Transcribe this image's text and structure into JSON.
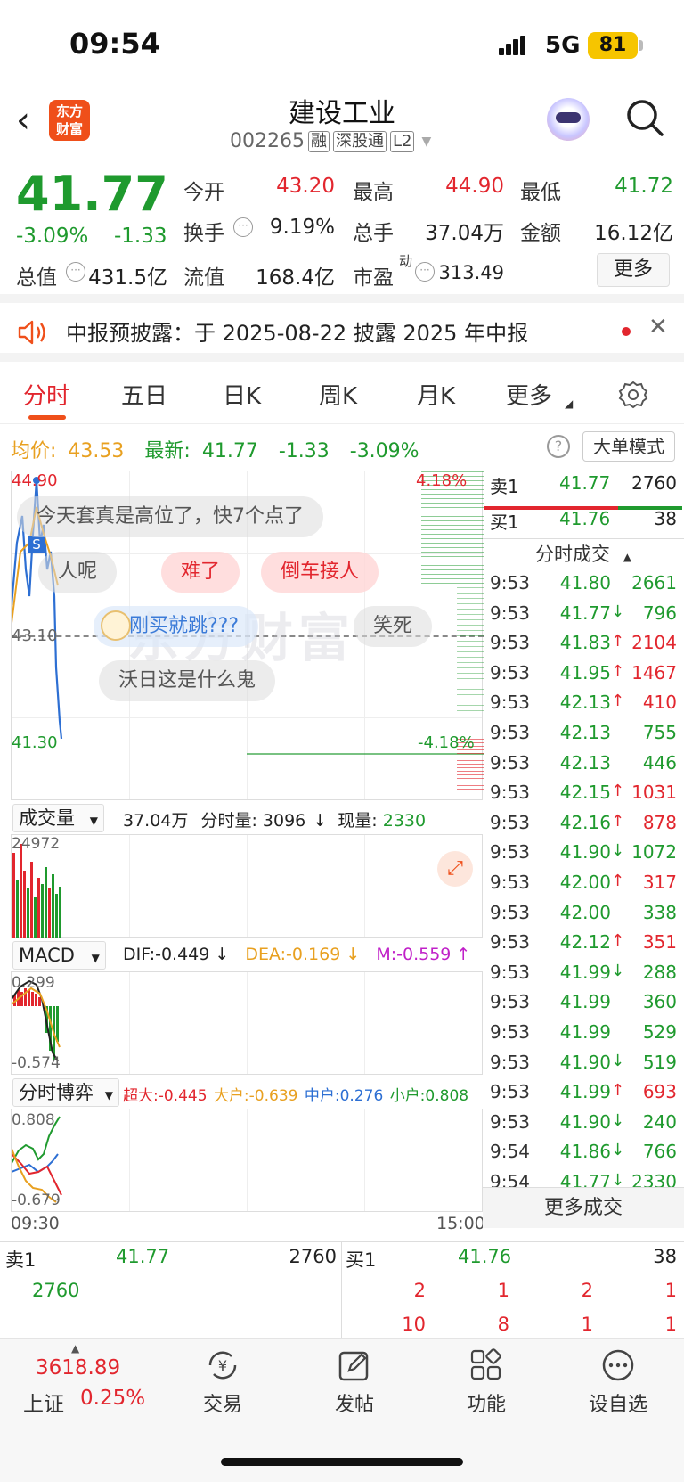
{
  "status_bar": {
    "time": "09:54",
    "network": "5G",
    "battery": "81"
  },
  "header": {
    "logo_line1": "东方",
    "logo_line2": "财富",
    "stock_name": "建设工业",
    "stock_code": "002265",
    "tags": [
      "融",
      "深股通",
      "L2"
    ]
  },
  "quote": {
    "price": "41.77",
    "change_pct": "-3.09%",
    "change": "-1.33",
    "open_label": "今开",
    "open": "43.20",
    "high_label": "最高",
    "high": "44.90",
    "low_label": "最低",
    "low": "41.72",
    "turnover_label": "换手",
    "turnover": "9.19%",
    "volume_label": "总手",
    "volume": "37.04万",
    "amount_label": "金额",
    "amount": "16.12亿",
    "mktcap_label": "总值",
    "mktcap": "431.5亿",
    "float_label": "流值",
    "float": "168.4亿",
    "pe_label": "市盈",
    "pe_sup": "动",
    "pe": "313.49",
    "more": "更多"
  },
  "notice": {
    "text": "中报预披露：于 2025-08-22 披露 2025 年中报"
  },
  "tabs": [
    "分时",
    "五日",
    "日K",
    "周K",
    "月K",
    "更多"
  ],
  "summary": {
    "avg_label": "均价:",
    "avg": "43.53",
    "latest_label": "最新:",
    "latest": "41.77",
    "change": "-1.33",
    "change_pct": "-3.09%",
    "big_mode": "大单模式"
  },
  "chart": {
    "top_price": "44.90",
    "mid_price": "43.10",
    "bottom_price": "41.30",
    "top_pct": "4.18%",
    "bottom_pct": "-4.18%",
    "marker": "S",
    "start_time": "09:30",
    "end_time": "15:00",
    "watermark": "东方财富"
  },
  "danmu": [
    "今天套真是高位了，快7个点了",
    "人呢",
    "难了",
    "倒车接人",
    "刚买就跳???",
    "笑死",
    "沃日这是什么鬼"
  ],
  "volume_panel": {
    "label": "成交量",
    "total": "37.04万",
    "period_label": "分时量:",
    "period": "3096",
    "current_label": "现量:",
    "current": "2330",
    "max": "24972"
  },
  "macd_panel": {
    "label": "MACD",
    "dif": "DIF:-0.449",
    "dea": "DEA:-0.169",
    "m": "M:-0.559",
    "top": "0.299",
    "bottom": "-0.574"
  },
  "game_panel": {
    "label": "分时博弈",
    "super": "超大:-0.445",
    "big": "大户:-0.639",
    "mid": "中户:0.276",
    "small": "小户:0.808",
    "top": "0.808",
    "bottom": "-0.679"
  },
  "orderbook": {
    "sell1_label": "卖1",
    "sell1_price": "41.77",
    "sell1_vol": "2760",
    "buy1_label": "买1",
    "buy1_price": "41.76",
    "buy1_vol": "38",
    "trades_title": "分时成交",
    "trades": [
      {
        "t": "9:53",
        "p": "41.80",
        "v": "2661",
        "d": ""
      },
      {
        "t": "9:53",
        "p": "41.77",
        "v": "796",
        "d": "down"
      },
      {
        "t": "9:53",
        "p": "41.83",
        "v": "2104",
        "d": "up"
      },
      {
        "t": "9:53",
        "p": "41.95",
        "v": "1467",
        "d": "up"
      },
      {
        "t": "9:53",
        "p": "42.13",
        "v": "410",
        "d": "up"
      },
      {
        "t": "9:53",
        "p": "42.13",
        "v": "755",
        "d": ""
      },
      {
        "t": "9:53",
        "p": "42.13",
        "v": "446",
        "d": ""
      },
      {
        "t": "9:53",
        "p": "42.15",
        "v": "1031",
        "d": "up"
      },
      {
        "t": "9:53",
        "p": "42.16",
        "v": "878",
        "d": "up"
      },
      {
        "t": "9:53",
        "p": "41.90",
        "v": "1072",
        "d": "down"
      },
      {
        "t": "9:53",
        "p": "42.00",
        "v": "317",
        "d": "up"
      },
      {
        "t": "9:53",
        "p": "42.00",
        "v": "338",
        "d": ""
      },
      {
        "t": "9:53",
        "p": "42.12",
        "v": "351",
        "d": "up"
      },
      {
        "t": "9:53",
        "p": "41.99",
        "v": "288",
        "d": "down"
      },
      {
        "t": "9:53",
        "p": "41.99",
        "v": "360",
        "d": ""
      },
      {
        "t": "9:53",
        "p": "41.99",
        "v": "529",
        "d": ""
      },
      {
        "t": "9:53",
        "p": "41.90",
        "v": "519",
        "d": "down"
      },
      {
        "t": "9:53",
        "p": "41.99",
        "v": "693",
        "d": "up"
      },
      {
        "t": "9:53",
        "p": "41.90",
        "v": "240",
        "d": "down"
      },
      {
        "t": "9:54",
        "p": "41.86",
        "v": "766",
        "d": "down"
      },
      {
        "t": "9:54",
        "p": "41.77",
        "v": "2330",
        "d": "down"
      }
    ],
    "more_trades": "更多成交",
    "queue_sell": [
      "2760"
    ],
    "queue_buy_row1": [
      "2",
      "1",
      "2",
      "1"
    ],
    "queue_buy_row2": [
      "10",
      "8",
      "1",
      "1"
    ]
  },
  "bottom_nav": {
    "index_value": "3618.89",
    "index_name": "上证",
    "index_pct": "0.25%",
    "items": [
      "交易",
      "发帖",
      "功能",
      "设自选"
    ]
  }
}
